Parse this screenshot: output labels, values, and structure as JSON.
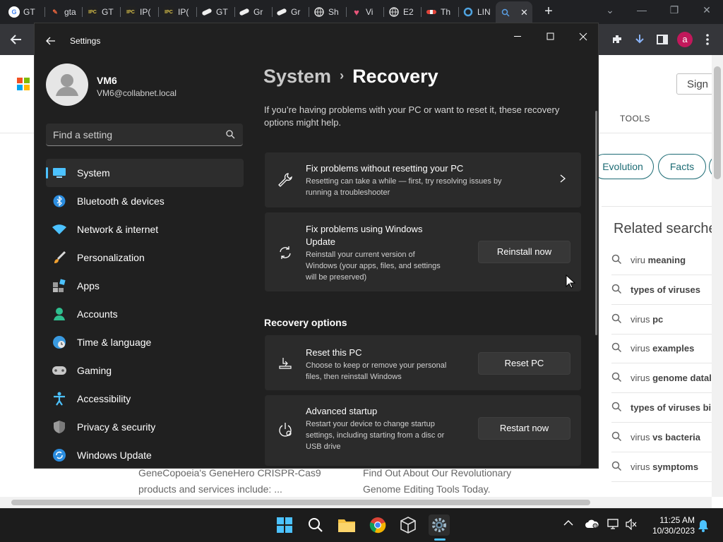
{
  "browser": {
    "tabs": [
      {
        "label": "GT",
        "icon": "google-icon"
      },
      {
        "label": "gta",
        "icon": "feather-icon"
      },
      {
        "label": "GT",
        "icon": "ipc-games-icon"
      },
      {
        "label": "IP(",
        "icon": "ipc-games-icon"
      },
      {
        "label": "IP(",
        "icon": "ipc-games-icon"
      },
      {
        "label": "GT",
        "icon": "pill-icon"
      },
      {
        "label": "Gr",
        "icon": "pill-icon"
      },
      {
        "label": "Gr",
        "icon": "pill-icon"
      },
      {
        "label": "Sh",
        "icon": "globe-icon"
      },
      {
        "label": "Vi",
        "icon": "heart-icon"
      },
      {
        "label": "E2",
        "icon": "globe-icon"
      },
      {
        "label": "Th",
        "icon": "tube-icon"
      },
      {
        "label": "LIN",
        "icon": "circle-icon"
      }
    ],
    "profile_initial": "a"
  },
  "webpage": {
    "sign_in": "Sign i",
    "tools": "TOOLS",
    "chips": [
      "Evolution",
      "Facts"
    ],
    "related_title": "Related searche",
    "related": [
      {
        "plain": "viru ",
        "bold": "meaning"
      },
      {
        "plain": "",
        "bold": "types of viruses"
      },
      {
        "plain": "virus ",
        "bold": "pc"
      },
      {
        "plain": "virus ",
        "bold": "examples"
      },
      {
        "plain": "virus ",
        "bold": "genome datal"
      },
      {
        "plain": "",
        "bold": "types of viruses bi"
      },
      {
        "plain": "virus ",
        "bold": "vs bacteria"
      },
      {
        "plain": "virus ",
        "bold": "symptoms"
      }
    ],
    "bottom_left_1": "GeneCopoeia's GeneHero CRISPR-Cas9",
    "bottom_left_2": "products and services include: ...",
    "bottom_right_1": "Find Out About Our Revolutionary",
    "bottom_right_2": "Genome Editing Tools Today."
  },
  "settings": {
    "title": "Settings",
    "user": {
      "name": "VM6",
      "email": "VM6@collabnet.local"
    },
    "search_placeholder": "Find a setting",
    "nav": [
      {
        "label": "System",
        "icon": "system-icon",
        "active": true
      },
      {
        "label": "Bluetooth & devices",
        "icon": "bluetooth-icon"
      },
      {
        "label": "Network & internet",
        "icon": "wifi-icon"
      },
      {
        "label": "Personalization",
        "icon": "brush-icon"
      },
      {
        "label": "Apps",
        "icon": "apps-icon"
      },
      {
        "label": "Accounts",
        "icon": "accounts-icon"
      },
      {
        "label": "Time & language",
        "icon": "globe-clock-icon"
      },
      {
        "label": "Gaming",
        "icon": "gamepad-icon"
      },
      {
        "label": "Accessibility",
        "icon": "accessibility-icon"
      },
      {
        "label": "Privacy & security",
        "icon": "shield-icon"
      },
      {
        "label": "Windows Update",
        "icon": "update-icon"
      }
    ],
    "breadcrumb": {
      "parent": "System",
      "separator": "›",
      "current": "Recovery"
    },
    "intro_line1": "If you’re having problems with your PC or want to reset it, these recovery",
    "intro_line2": "options might help.",
    "cards": {
      "fix_no_reset": {
        "title": "Fix problems without resetting your PC",
        "desc1": "Resetting can take a while — first, try resolving issues by",
        "desc2": "running a troubleshooter"
      },
      "fix_update": {
        "title1": "Fix problems using Windows",
        "title2": "Update",
        "desc1": "Reinstall your current version of",
        "desc2": "Windows (your apps, files, and settings",
        "desc3": "will be preserved)",
        "button": "Reinstall now"
      }
    },
    "section_title": "Recovery options",
    "recovery": {
      "reset": {
        "title": "Reset this PC",
        "desc1": "Choose to keep or remove your personal",
        "desc2": "files, then reinstall Windows",
        "button": "Reset PC"
      },
      "advanced": {
        "title": "Advanced startup",
        "desc1": "Restart your device to change startup",
        "desc2": "settings, including starting from a disc or",
        "desc3": "USB drive",
        "button": "Restart now"
      }
    }
  },
  "taskbar": {
    "time": "11:25 AM",
    "date": "10/30/2023",
    "apps": [
      "start-icon",
      "search-icon",
      "file-explorer-icon",
      "chrome-icon",
      "virtualbox-icon",
      "settings-icon"
    ]
  },
  "colors": {
    "accent": "#4cc2ff",
    "window_bg": "#202020",
    "card_bg": "#2b2b2b"
  }
}
